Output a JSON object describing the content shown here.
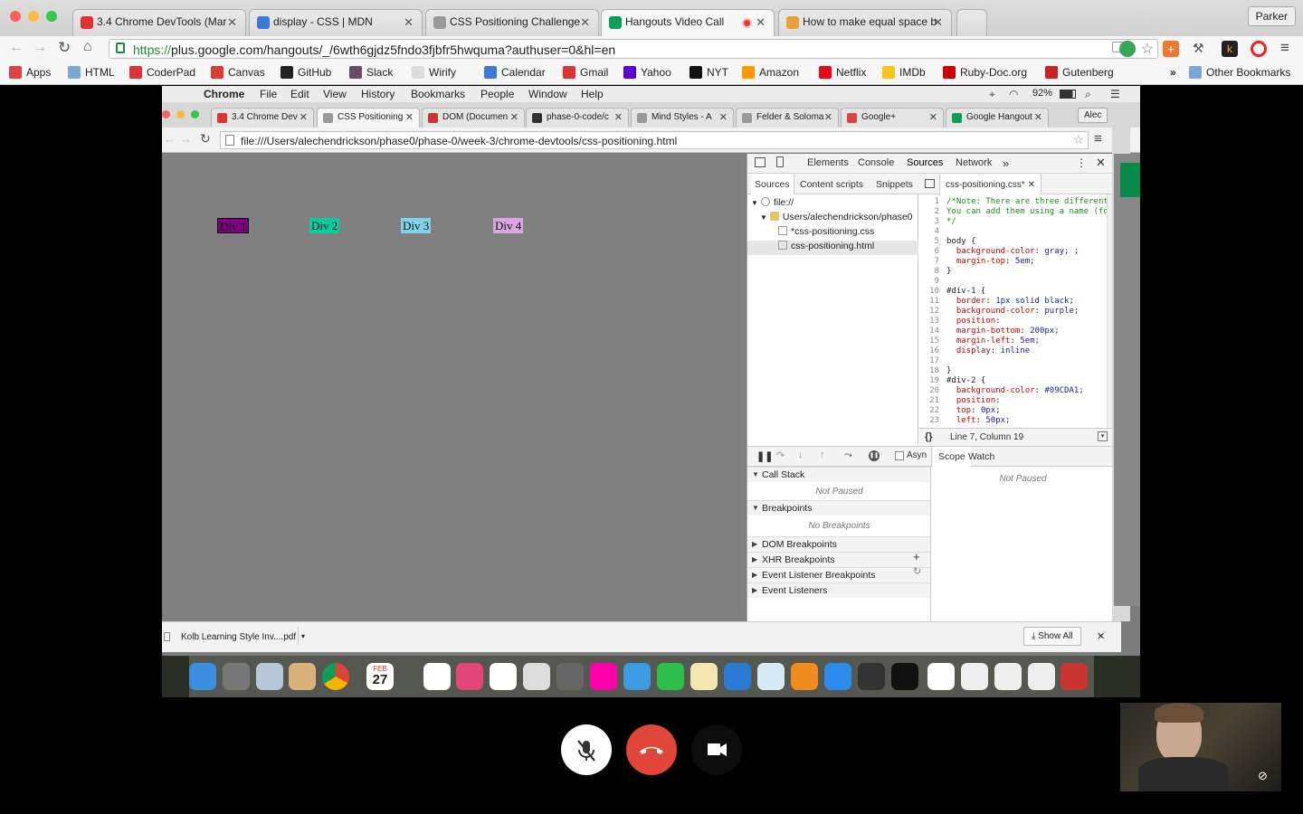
{
  "outer_tabs": [
    {
      "title": "3.4 Chrome DevTools (Mar",
      "color": "#d33"
    },
    {
      "title": "display - CSS | MDN",
      "color": "#3b7bd4"
    },
    {
      "title": "CSS Positioning Challenge",
      "color": "#999"
    },
    {
      "title": "Hangouts Video Call",
      "color": "#0f9d58",
      "recording": true
    },
    {
      "title": "How to make equal space b",
      "color": "#e8a03a"
    }
  ],
  "profile": "Parker",
  "url": {
    "scheme": "https://",
    "rest": "plus.google.com/hangouts/_/6wth6gjdz5fndo3fjbfr5hwquma?authuser=0&hl=en"
  },
  "bookmarks": [
    {
      "label": "Apps",
      "color": "#d44"
    },
    {
      "label": "HTML",
      "color": "#7aa7d6"
    },
    {
      "label": "CoderPad",
      "color": "#d33"
    },
    {
      "label": "Canvas",
      "color": "#e03b2f"
    },
    {
      "label": "GitHub",
      "color": "#222"
    },
    {
      "label": "Slack",
      "color": "#6b4a6b"
    },
    {
      "label": "Wirify",
      "color": "#ddd"
    },
    {
      "label": "Calendar",
      "color": "#3b7bd4"
    },
    {
      "label": "Gmail",
      "color": "#d33"
    },
    {
      "label": "Yahoo",
      "color": "#5f01d1"
    },
    {
      "label": "NYT",
      "color": "#111"
    },
    {
      "label": "Amazon",
      "color": "#f90"
    },
    {
      "label": "Netflix",
      "color": "#e50914"
    },
    {
      "label": "IMDb",
      "color": "#f5c518"
    },
    {
      "label": "Ruby-Doc.org",
      "color": "#c00"
    },
    {
      "label": "Gutenberg",
      "color": "#c22"
    }
  ],
  "other_bookmarks": "Other Bookmarks",
  "mac_menu": [
    "Chrome",
    "File",
    "Edit",
    "View",
    "History",
    "Bookmarks",
    "People",
    "Window",
    "Help"
  ],
  "battery": "92%",
  "inner_tabs": [
    "3.4 Chrome Dev",
    "CSS Positioning",
    "DOM (Documen",
    "phase-0-code/c",
    "Mind Styles - A",
    "Felder & Soloma",
    "Google+",
    "Google Hangout"
  ],
  "inner_profile": "Alec",
  "inner_url": "file:///Users/alechendrickson/phase0/phase-0/week-3/chrome-devtools/css-positioning.html",
  "page_divs": [
    {
      "label": "Div 1",
      "bg": "#800080",
      "color": "#111",
      "border": true
    },
    {
      "label": "Div 2",
      "bg": "#09CDA1",
      "color": "#111",
      "border": false
    },
    {
      "label": "Div 3",
      "bg": "#7fd3e8",
      "color": "#111",
      "border": false
    },
    {
      "label": "Div 4",
      "bg": "#d9a6e0",
      "color": "#111",
      "border": false
    }
  ],
  "devtools": {
    "tabs": [
      "Elements",
      "Console",
      "Sources",
      "Network"
    ],
    "nav_tabs": [
      "Sources",
      "Content scripts",
      "Snippets"
    ],
    "open_file": "css-positioning.css*",
    "tree": [
      "file://",
      "Users/alechendrickson/phase0",
      "*css-positioning.css",
      "css-positioning.html"
    ],
    "code": [
      "/*Note: There are three different",
      "You can add them using a name (fo",
      "*/",
      "",
      "body {",
      "  background-color: gray; ;",
      "  margin-top: 5em;",
      "}",
      "",
      "#div-1 {",
      "  border: 1px solid black;",
      "  background-color: purple;",
      "  position:",
      "  margin-bottom: 200px;",
      "  margin-left: 5em;",
      "  display: inline",
      "",
      "}",
      "#div-2 {",
      "  background-color: #09CDA1;",
      "  position:",
      "  top: 0px;",
      "  left: 50px;"
    ],
    "status": "Line 7, Column 19",
    "async_label": "Asyn",
    "call_stack": "Call Stack",
    "not_paused": "Not Paused",
    "breakpoints": "Breakpoints",
    "no_breakpoints": "No Breakpoints",
    "sections": [
      "DOM Breakpoints",
      "XHR Breakpoints",
      "Event Listener Breakpoints",
      "Event Listeners"
    ],
    "scope": "Scope",
    "watch": "Watch"
  },
  "download": {
    "file": "Kolb Learning Style Inv....pdf",
    "show_all": "Show All"
  },
  "dock_calendar": {
    "month": "FEB",
    "day": "27"
  }
}
